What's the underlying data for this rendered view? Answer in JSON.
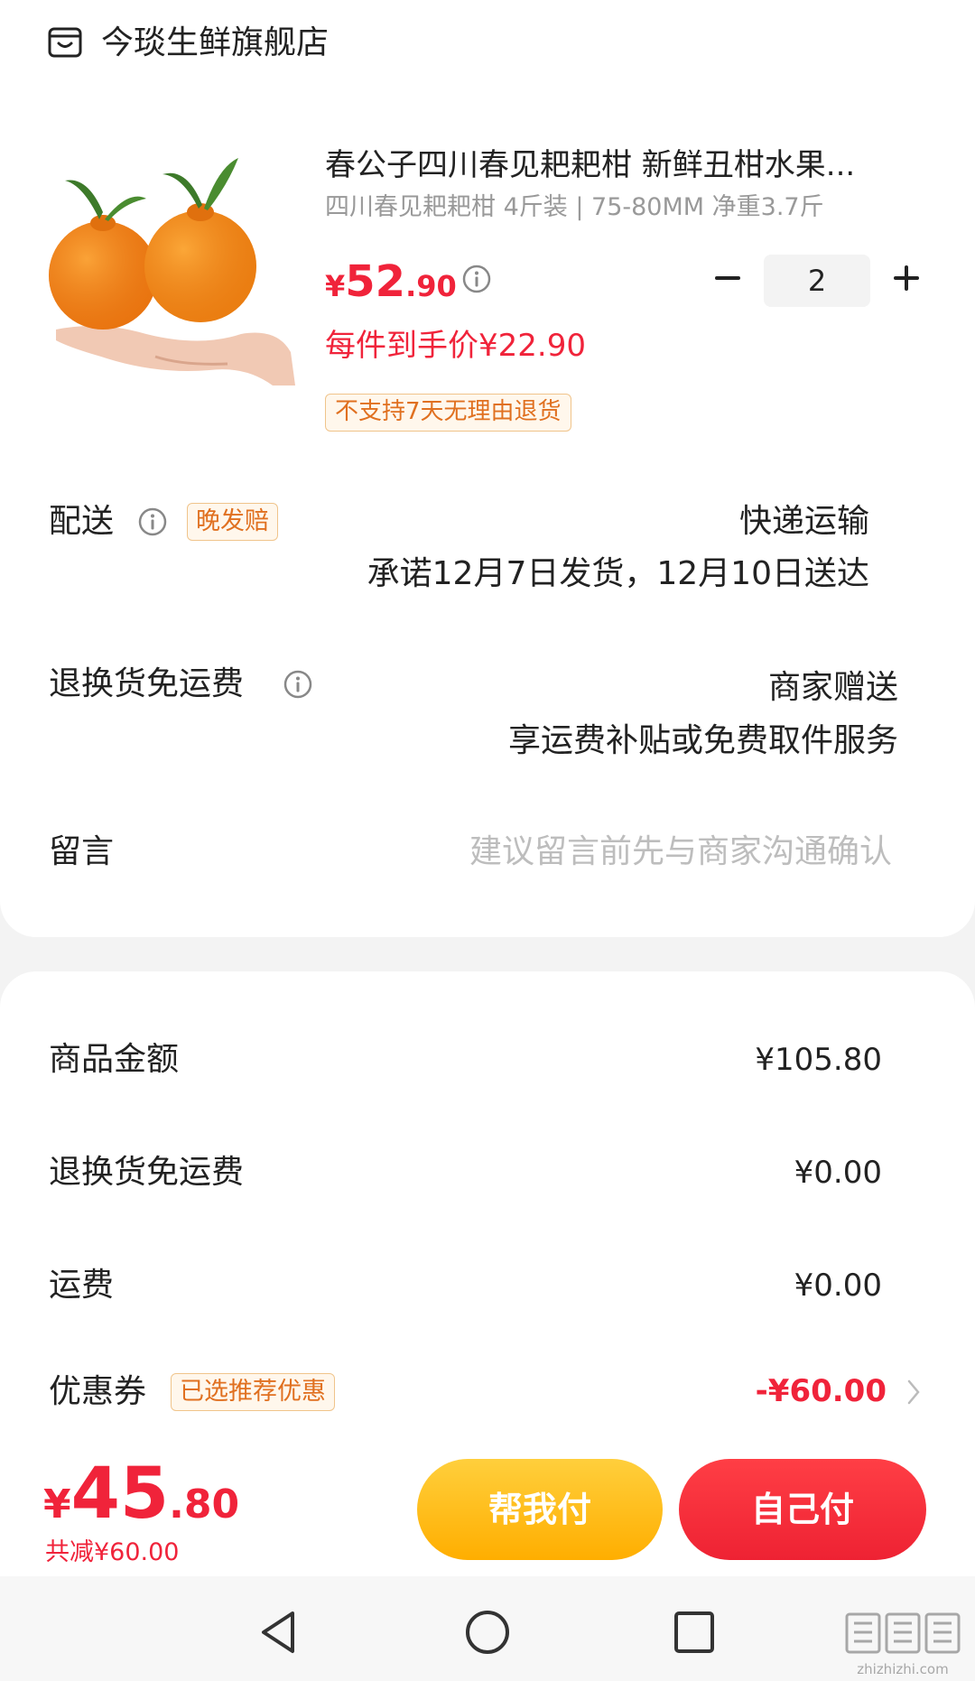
{
  "store": {
    "name": "今琰生鲜旗舰店"
  },
  "product": {
    "title": "春公子四川春见耙耙柑 新鲜丑柑水果...",
    "spec": "四川春见耙耙柑 4斤装 | 75-80MM 净重3.7斤",
    "price_symbol": "¥",
    "price_int": "52",
    "price_dec": ".90",
    "quantity": "2",
    "per_item_price": "每件到手价¥22.90",
    "return_policy_tag": "不支持7天无理由退货"
  },
  "delivery": {
    "label": "配送",
    "tag": "晚发赔",
    "method": "快递运输",
    "promise": "承诺12月7日发货，12月10日送达"
  },
  "return_shipping": {
    "label": "退换货免运费",
    "value": "商家赠送",
    "desc": "享运费补贴或免费取件服务"
  },
  "message": {
    "label": "留言",
    "placeholder": "建议留言前先与商家沟通确认"
  },
  "summary": {
    "rows": [
      {
        "label": "商品金额",
        "value": "¥105.80"
      },
      {
        "label": "退换货免运费",
        "value": "¥0.00"
      },
      {
        "label": "运费",
        "value": "¥0.00"
      }
    ],
    "coupon": {
      "label": "优惠券",
      "tag": "已选推荐优惠",
      "value": "-¥60.00"
    }
  },
  "footer": {
    "total_symbol": "¥",
    "total_int": "45",
    "total_dec": ".80",
    "saved": "共减¥60.00",
    "help_pay": "帮我付",
    "self_pay": "自己付"
  },
  "watermark": {
    "text": "值值值",
    "site": "zhizhizhi.com"
  },
  "colors": {
    "accent_red": "#f0233a",
    "button_yellow": "#ffb800",
    "tag_orange": "#e07020"
  }
}
